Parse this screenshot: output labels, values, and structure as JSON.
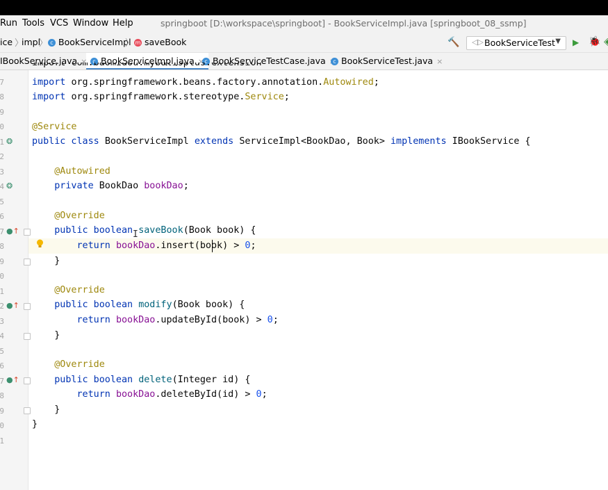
{
  "menu": {
    "items": [
      "Run",
      "Tools",
      "VCS",
      "Window",
      "Help"
    ],
    "window_title": "springboot [D:\\workspace\\springboot] - BookServiceImpl.java [springboot_08_ssmp]"
  },
  "breadcrumb": {
    "items": [
      "ice",
      "impl",
      "BookServiceImpl",
      "saveBook"
    ]
  },
  "toolbar": {
    "run_config": "BookServiceTest"
  },
  "tabs": [
    {
      "label": "IBookService.java",
      "active": false
    },
    {
      "label": "BookServiceImpl.java",
      "active": true
    },
    {
      "label": "BookServiceTestCase.java",
      "active": false
    },
    {
      "label": "BookServiceTest.java",
      "active": false
    }
  ],
  "gutter": {
    "line_numbers": [
      "7",
      "8",
      "9",
      "0",
      "1",
      "2",
      "3",
      "4",
      "5",
      "6",
      "7",
      "8",
      "9",
      "0",
      "1",
      "2",
      "3",
      "4",
      "5",
      "6",
      "7",
      "8",
      "9",
      "0",
      "1"
    ]
  },
  "code": {
    "l0_partial": "import com.baomidou.mybatisplus.extension.service.impl.ServiceImpl;",
    "l1_a": "import ",
    "l1_b": "org.springframework.beans.factory.annotation.",
    "l1_c": "Autowired",
    "l1_d": ";",
    "l2_a": "import ",
    "l2_b": "org.springframework.stereotype.",
    "l2_c": "Service",
    "l2_d": ";",
    "l4_ann": "@Service",
    "l5_kw1": "public class ",
    "l5_name": "BookServiceImpl ",
    "l5_kw2": "extends ",
    "l5_base": "ServiceImpl<BookDao, Book> ",
    "l5_kw3": "implements ",
    "l5_iface": "IBookService {",
    "l7_ann": "@Autowired",
    "l8_kw": "private ",
    "l8_type": "BookDao ",
    "l8_fld": "bookDao",
    "l8_end": ";",
    "l10_ann": "@Override",
    "l11_kw": "public boolean ",
    "l11_meth": "saveBook",
    "l11_rest": "(Book book) {",
    "l12_kw": "return ",
    "l12_fld": "bookDao",
    "l12_call": ".insert(book) > ",
    "l12_num": "0",
    "l12_end": ";",
    "l13": "}",
    "l15_ann": "@Override",
    "l16_kw": "public boolean ",
    "l16_meth": "modify",
    "l16_rest": "(Book book) {",
    "l17_kw": "return ",
    "l17_fld": "bookDao",
    "l17_call": ".updateById(book) > ",
    "l17_num": "0",
    "l17_end": ";",
    "l18": "}",
    "l20_ann": "@Override",
    "l21_kw": "public boolean ",
    "l21_meth": "delete",
    "l21_rest": "(Integer id) {",
    "l22_kw": "return ",
    "l22_fld": "bookDao",
    "l22_call": ".deleteById(id) > ",
    "l22_num": "0",
    "l22_end": ";",
    "l23": "}",
    "l24": "}"
  },
  "colors": {
    "keyword": "#0033b3",
    "annotation": "#9e880d",
    "field": "#871094",
    "number": "#1750eb",
    "current_line": "#fcfaed"
  }
}
